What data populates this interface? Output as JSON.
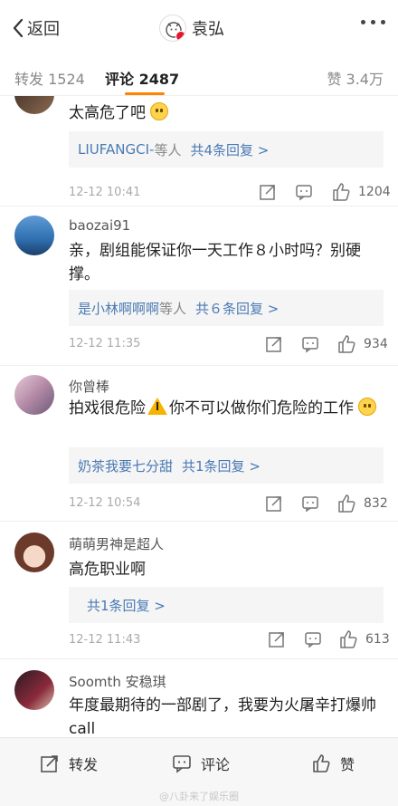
{
  "nav": {
    "back_label": "返回",
    "title": "袁弘"
  },
  "tabs": {
    "repost": "转发 1524",
    "comments": "评论 2487",
    "likes": "赞 3.4万"
  },
  "comments": [
    {
      "username": "",
      "text": "太高危了吧",
      "reply_names": "LIUFANGCI-",
      "reply_suffix": "等人",
      "reply_count": "共4条回复 >",
      "time": "12-12 10:41",
      "likes": "1204"
    },
    {
      "username": "baozai91",
      "text": "亲，剧组能保证你一天工作８小时吗？别硬撑。",
      "reply_names": "是小林啊啊啊",
      "reply_suffix": "等人",
      "reply_count": "共６条回复 >",
      "time": "12-12 11:35",
      "likes": "934"
    },
    {
      "username": "你曾棒",
      "text_a": "拍戏很危险",
      "text_b": "你不可以做你们危险的工作",
      "reply_names": "奶茶我要七分甜",
      "reply_suffix": "",
      "reply_count": "共1条回复 >",
      "time": "12-12 10:54",
      "likes": "832"
    },
    {
      "username": "萌萌男神是超人",
      "text": "高危职业啊",
      "reply_names": "",
      "reply_suffix": "",
      "reply_count": "共1条回复 >",
      "time": "12-12 11:43",
      "likes": "613"
    },
    {
      "username": "Soomth 安稳琪",
      "text": "年度最期待的一部剧了，我要为火屠辛打爆帅call"
    }
  ],
  "bottom": {
    "repost": "转发",
    "comment": "评论",
    "like": "赞"
  },
  "watermark": "@八卦来了娱乐圈",
  "colors": {
    "accent": "#ff8200",
    "link": "#4a7ab5",
    "vbadge": "#e6162d"
  }
}
